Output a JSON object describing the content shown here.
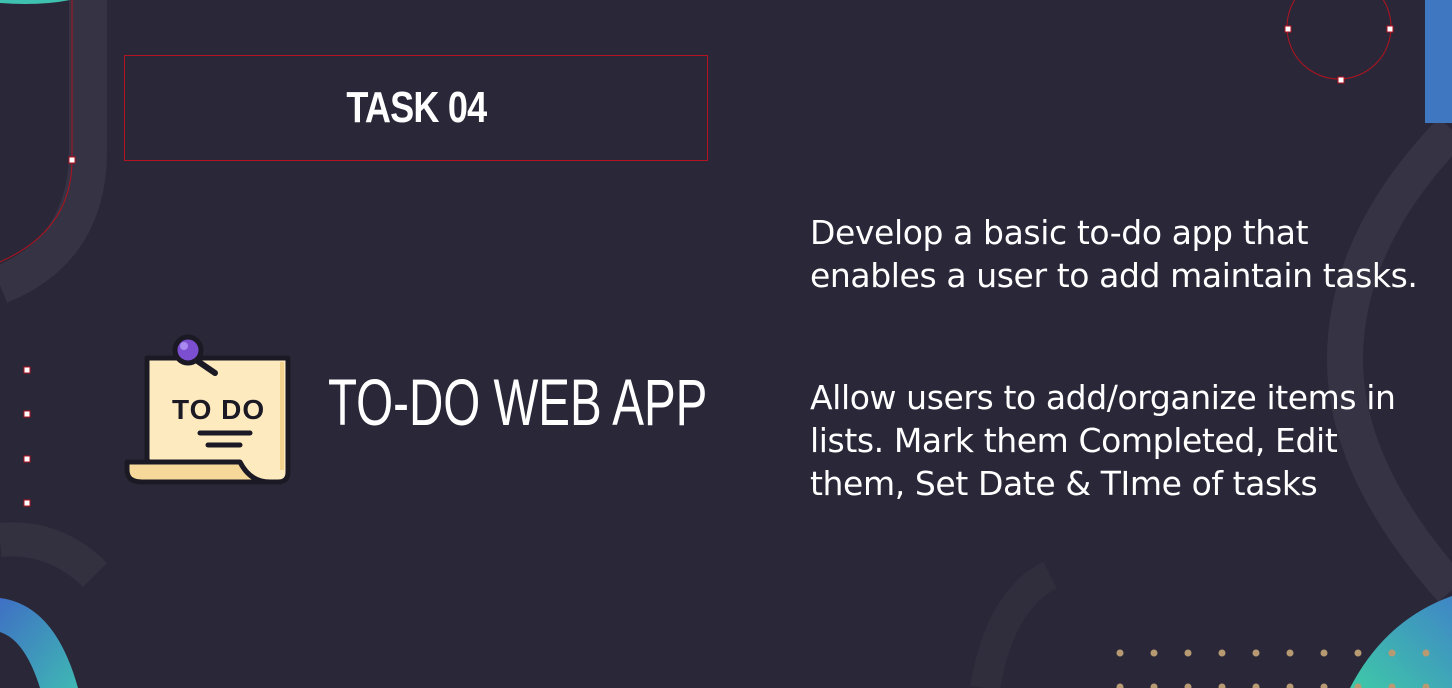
{
  "slide": {
    "task_label": "TASK 04",
    "project_title": "TO-DO WEB APP",
    "icon_text": "TO DO",
    "description": [
      "Develop a basic to-do app that enables a user to add maintain tasks.",
      "Allow users to add/organize items in lists. Mark them Completed, Edit them, Set Date & TIme of tasks"
    ]
  },
  "colors": {
    "background": "#2a2838",
    "accent_red": "#b3121f",
    "note_paper": "#fdeabf",
    "pin_purple": "#7c4fd1",
    "teal": "#3fc1b0",
    "blue": "#3f77c0",
    "dot_tan": "#b89a72"
  },
  "icons": {
    "todo_note": "sticky-note-icon",
    "pin": "push-pin-icon"
  }
}
